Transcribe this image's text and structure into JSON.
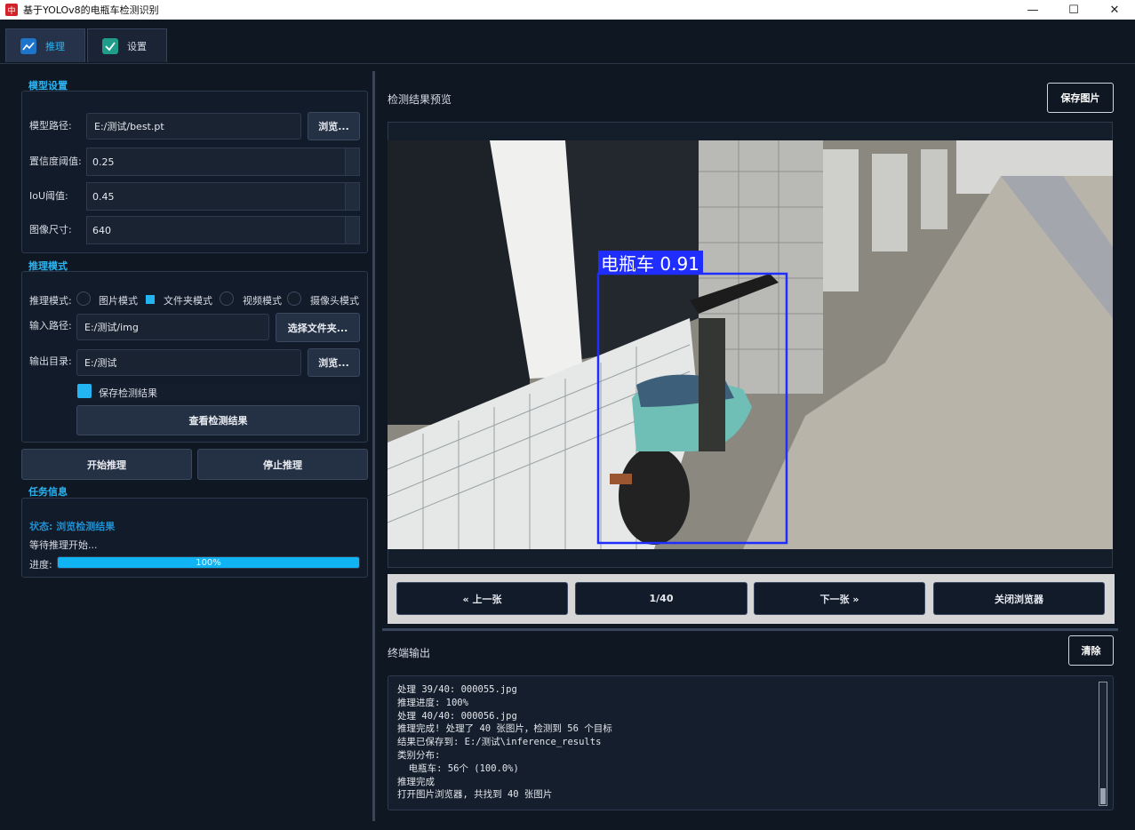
{
  "window": {
    "title": "基于YOLOv8的电瓶车检测识别",
    "icon_text": "中",
    "minimize": "—",
    "maximize": "☐",
    "close": "✕"
  },
  "tabs": [
    {
      "label": "推理",
      "icon": "chart-icon",
      "active": true
    },
    {
      "label": "设置",
      "icon": "check-icon",
      "active": false
    }
  ],
  "model_settings": {
    "title": "模型设置",
    "model_path_label": "模型路径:",
    "model_path_value": "E:/测试/best.pt",
    "browse_label": "浏览...",
    "conf_label": "置信度阈值:",
    "conf_value": "0.25",
    "iou_label": "IoU阈值:",
    "iou_value": "0.45",
    "imgsz_label": "图像尺寸:",
    "imgsz_value": "640"
  },
  "inference_mode": {
    "title": "推理模式",
    "mode_label": "推理模式:",
    "modes": [
      "图片模式",
      "文件夹模式",
      "视频模式",
      "摄像头模式"
    ],
    "selected_mode": "文件夹模式",
    "input_label": "输入路径:",
    "input_value": "E:/测试/img",
    "select_folder_label": "选择文件夹...",
    "output_label": "输出目录:",
    "output_value": "E:/测试",
    "browse_label": "浏览...",
    "save_results_label": "保存检测结果",
    "save_results_checked": true,
    "view_results_label": "查看检测结果"
  },
  "actions": {
    "start_label": "开始推理",
    "stop_label": "停止推理"
  },
  "task_info": {
    "title": "任务信息",
    "status_text": "状态: 浏览检测结果",
    "waiting_text": "等待推理开始...",
    "progress_label": "进度:",
    "progress_percent": 100,
    "progress_text": "100%"
  },
  "preview": {
    "title": "检测结果预览",
    "save_image_label": "保存图片",
    "detection_label": "电瓶车 0.91",
    "detection_color": "#1f2dff"
  },
  "navigation": {
    "prev_label": "« 上一张",
    "counter": "1/40",
    "next_label": "下一张 »",
    "close_label": "关闭浏览器"
  },
  "terminal": {
    "title": "终端输出",
    "clear_label": "清除",
    "lines": [
      "处理 39/40: 000055.jpg",
      "推理进度: 100%",
      "处理 40/40: 000056.jpg",
      "推理完成! 处理了 40 张图片，检测到 56 个目标",
      "结果已保存到: E:/测试\\inference_results",
      "类别分布:",
      "  电瓶车: 56个 (100.0%)",
      "推理完成",
      "打开图片浏览器, 共找到 40 张图片"
    ]
  },
  "colors": {
    "accent": "#2bb3f0",
    "background": "#0f1723",
    "panel": "#121b29",
    "progress_fill": "#10b4f2"
  }
}
